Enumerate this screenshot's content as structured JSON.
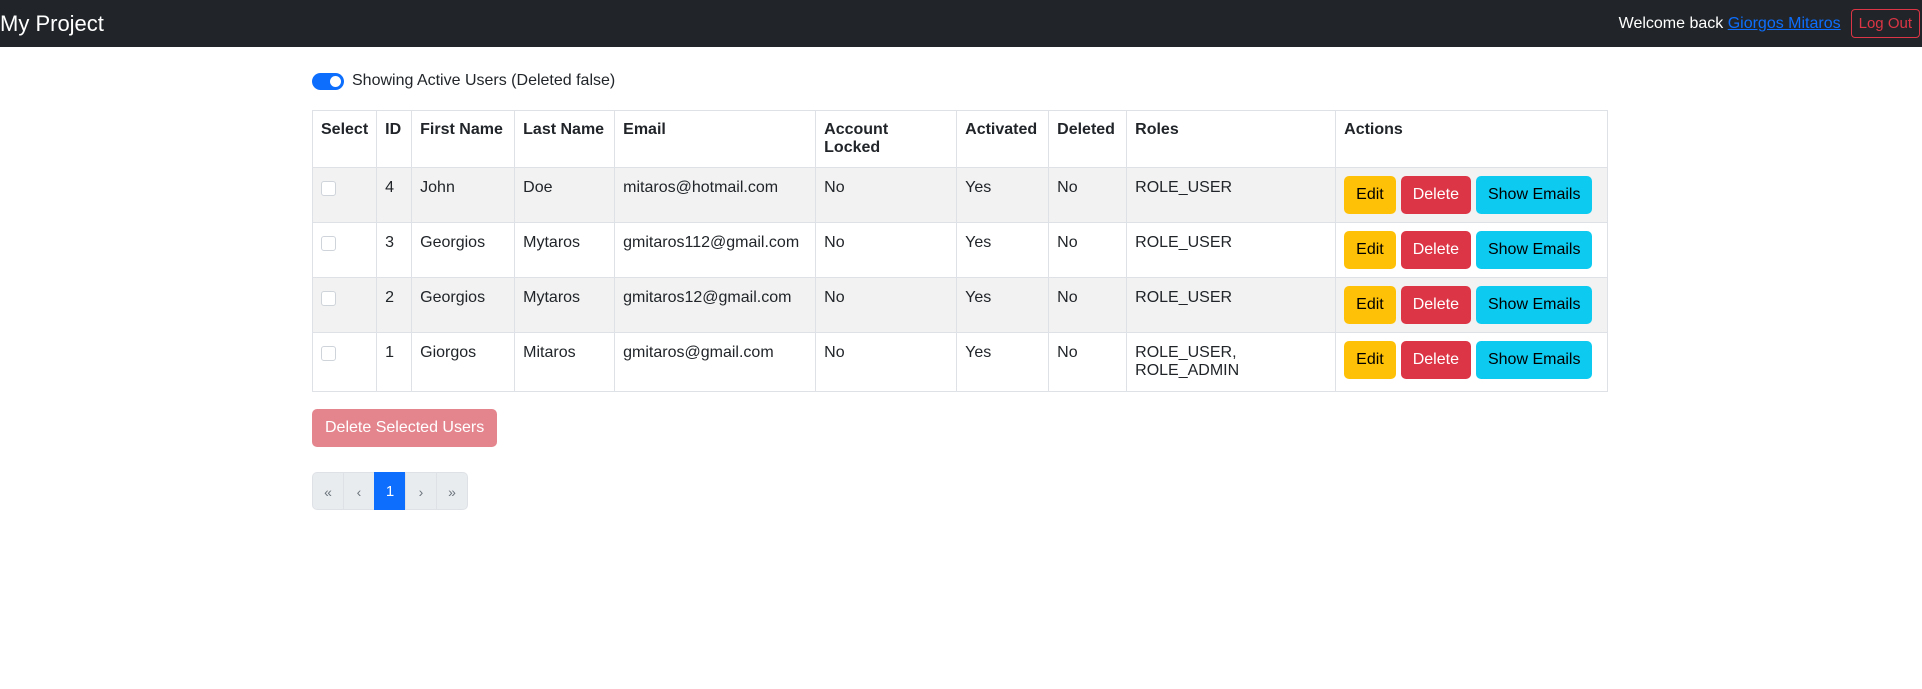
{
  "header": {
    "brand": "My Project",
    "welcome_prefix": "Welcome back ",
    "user_name": "Giorgos Mitaros",
    "logout_label": "Log Out"
  },
  "filter": {
    "switch_on": true,
    "label": "Showing Active Users (Deleted false)"
  },
  "table": {
    "columns": [
      "Select",
      "ID",
      "First Name",
      "Last Name",
      "Email",
      "Account Locked",
      "Activated",
      "Deleted",
      "Roles",
      "Actions"
    ],
    "rows": [
      {
        "id": "4",
        "first": "John",
        "last": "Doe",
        "email": "mitaros@hotmail.com",
        "locked": "No",
        "activated": "Yes",
        "deleted": "No",
        "roles": "ROLE_USER"
      },
      {
        "id": "3",
        "first": "Georgios",
        "last": "Mytaros",
        "email": "gmitaros112@gmail.com",
        "locked": "No",
        "activated": "Yes",
        "deleted": "No",
        "roles": "ROLE_USER"
      },
      {
        "id": "2",
        "first": "Georgios",
        "last": "Mytaros",
        "email": "gmitaros12@gmail.com",
        "locked": "No",
        "activated": "Yes",
        "deleted": "No",
        "roles": "ROLE_USER"
      },
      {
        "id": "1",
        "first": "Giorgos",
        "last": "Mitaros",
        "email": "gmitaros@gmail.com",
        "locked": "No",
        "activated": "Yes",
        "deleted": "No",
        "roles": "ROLE_USER, ROLE_ADMIN"
      }
    ],
    "actions": {
      "edit": "Edit",
      "delete": "Delete",
      "show_emails": "Show Emails"
    }
  },
  "delete_selected_label": "Delete Selected Users",
  "pagination": {
    "first": "«",
    "prev": "‹",
    "current": "1",
    "next": "›",
    "last": "»"
  },
  "colors": {
    "navbar": "#212529",
    "primary": "#0d6efd",
    "warning": "#ffc107",
    "danger": "#dc3545",
    "info": "#0dcaf0"
  }
}
